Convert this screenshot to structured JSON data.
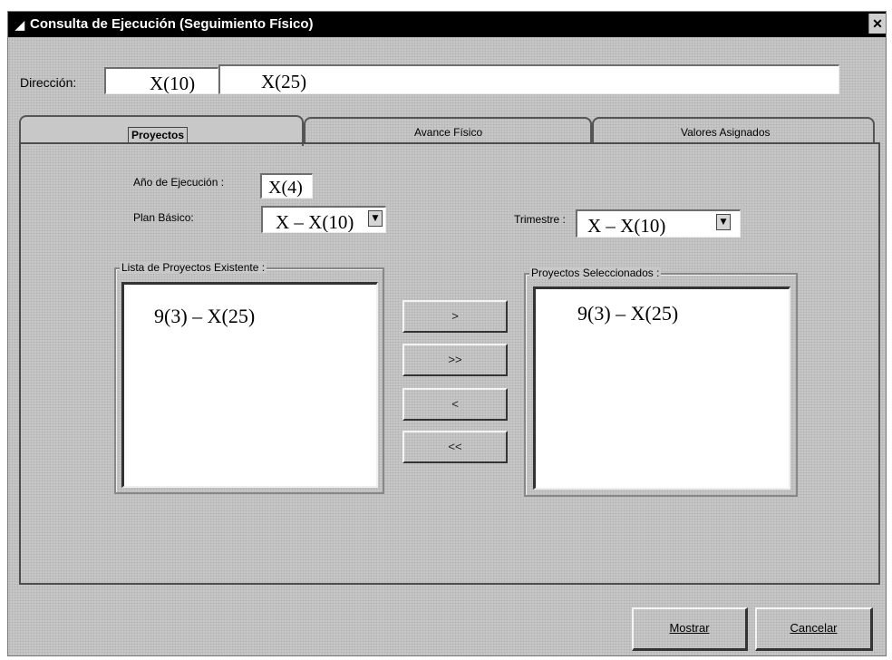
{
  "window": {
    "title": "Consulta de Ejecución (Seguimiento Físico)",
    "close_glyph": "✕"
  },
  "direccion": {
    "label": "Dirección:",
    "code": "X(10)",
    "name": "X(25)"
  },
  "tabs": [
    {
      "label": "Proyectos",
      "selected": true
    },
    {
      "label": "Avance Físico",
      "selected": false
    },
    {
      "label": "Valores Asignados",
      "selected": false
    }
  ],
  "form": {
    "anio_label": "Año de Ejecución :",
    "anio_value": "X(4)",
    "plan_label": "Plan Básico:",
    "plan_value": "X – X(10)",
    "trimestre_label": "Trimestre :",
    "trimestre_value": "X – X(10)"
  },
  "lists": {
    "existentes_title": "Lista de Proyectos Existente :",
    "existentes_item": "9(3) – X(25)",
    "seleccionados_title": "Proyectos Seleccionados :",
    "seleccionados_item": "9(3) – X(25)"
  },
  "move_buttons": {
    "add_one": ">",
    "add_all": ">>",
    "remove_one": "<",
    "remove_all": "<<"
  },
  "actions": {
    "mostrar": "Mostrar",
    "cancelar": "Cancelar"
  },
  "icons": {
    "title": "window-app-icon",
    "close": "close-icon",
    "dropdown": "chevron-down-icon"
  },
  "colors": {
    "titlebar": "#000000",
    "dialog_face": "#c8c8c8",
    "field": "#ffffff"
  }
}
